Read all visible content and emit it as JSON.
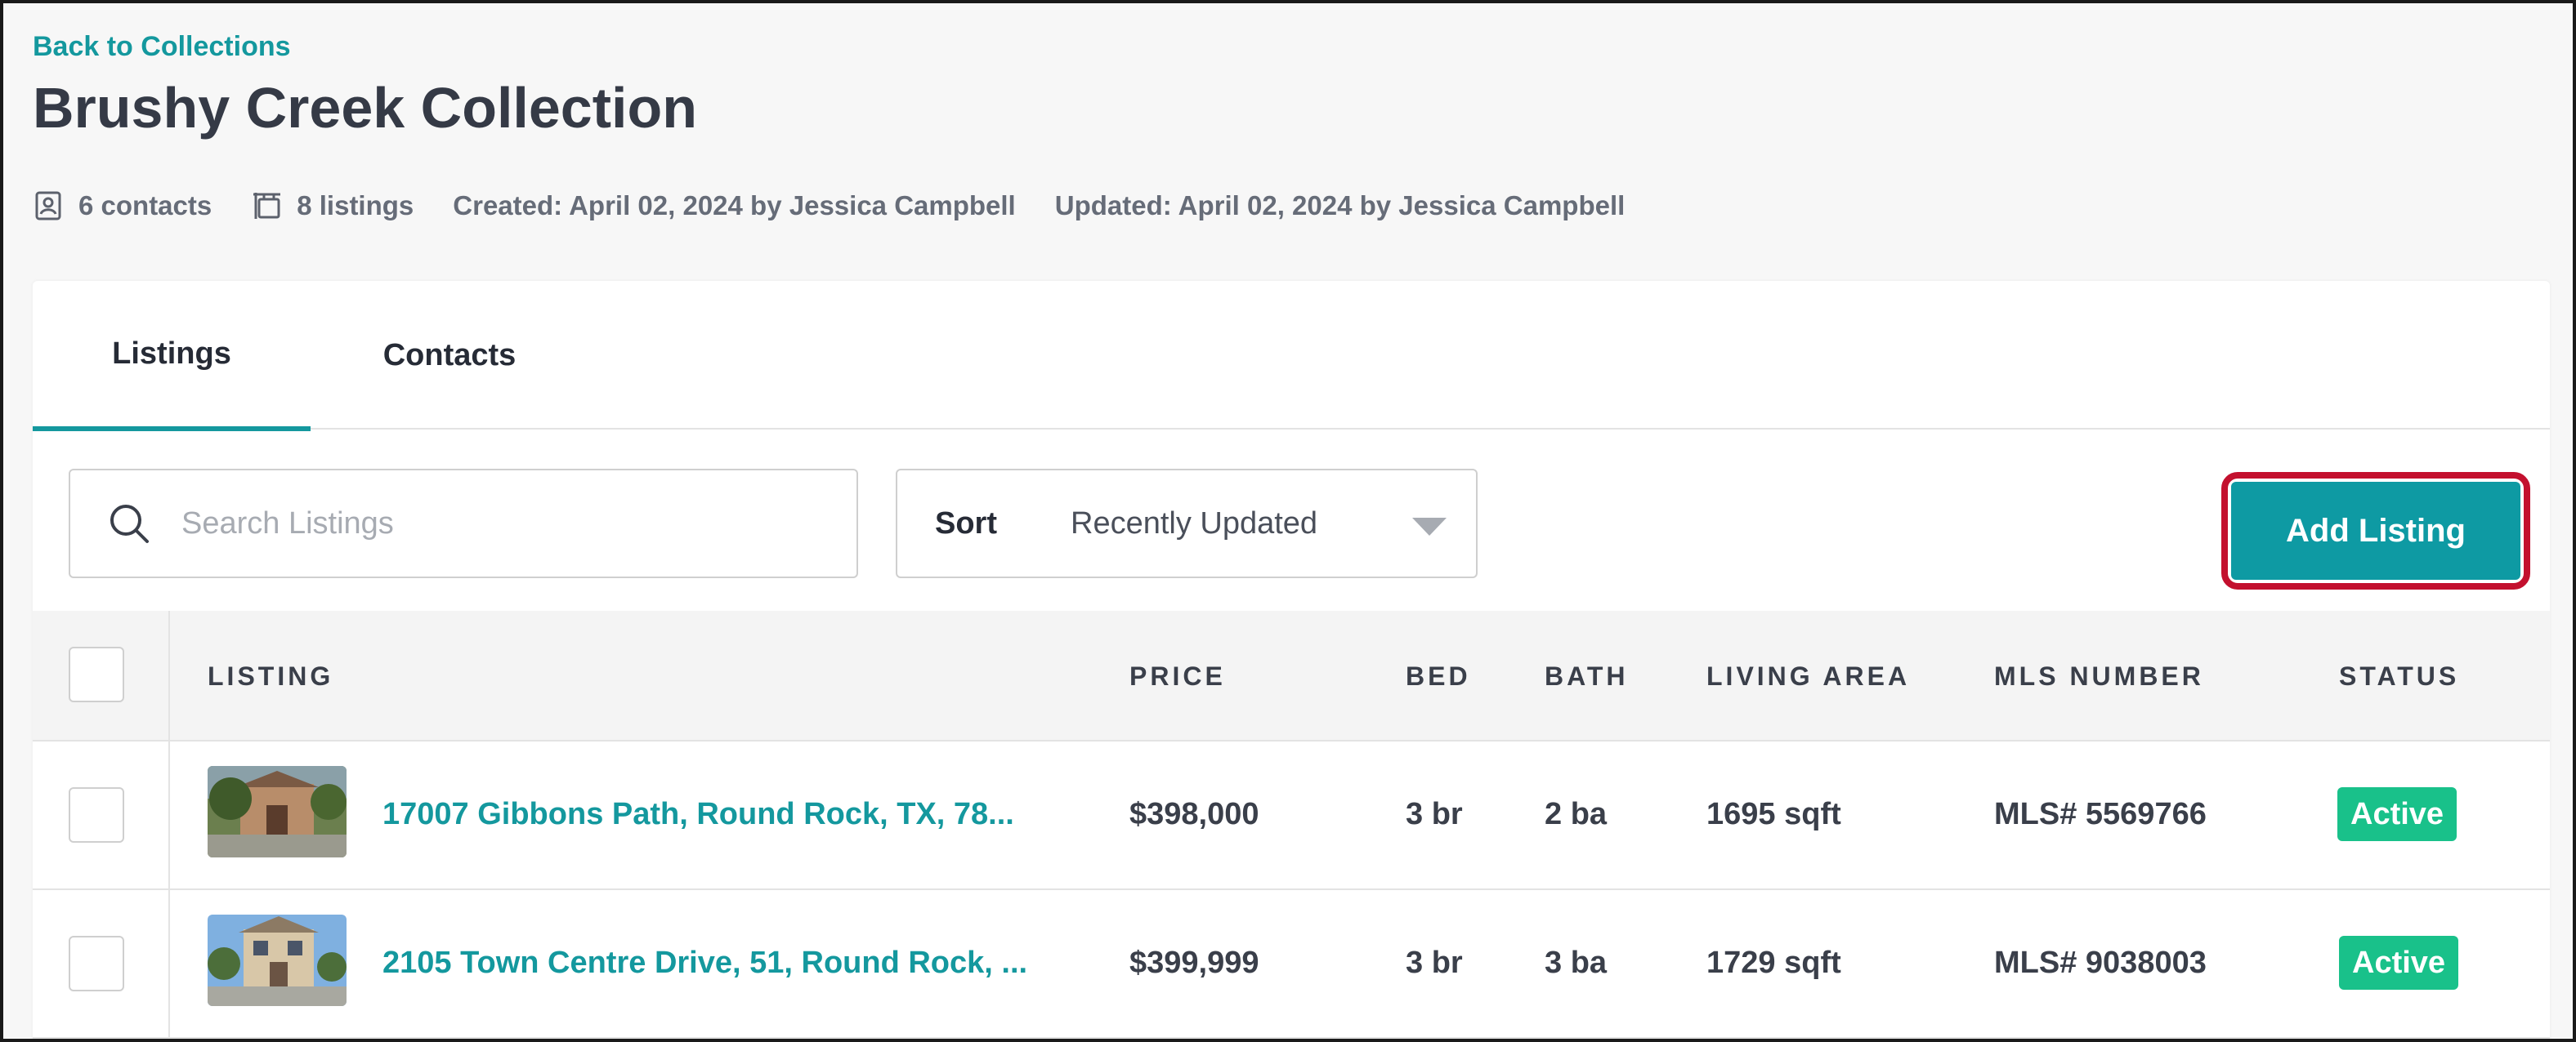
{
  "header": {
    "back_link": "Back to Collections",
    "title": "Brushy Creek Collection"
  },
  "meta": {
    "contacts": "6 contacts",
    "listings": "8 listings",
    "created": "Created: April 02, 2024 by Jessica Campbell",
    "updated": "Updated: April 02, 2024 by Jessica Campbell"
  },
  "tabs": [
    {
      "label": "Listings",
      "active": true
    },
    {
      "label": "Contacts",
      "active": false
    }
  ],
  "toolbar": {
    "search_placeholder": "Search Listings",
    "sort_label": "Sort",
    "sort_value": "Recently Updated",
    "add_label": "Add Listing"
  },
  "table": {
    "headers": {
      "listing": "LISTING",
      "price": "PRICE",
      "bed": "BED",
      "bath": "BATH",
      "living_area": "LIVING AREA",
      "mls": "MLS NUMBER",
      "status": "STATUS"
    },
    "rows": [
      {
        "address": "17007 Gibbons Path, Round Rock, TX, 78...",
        "price": "$398,000",
        "bed": "3 br",
        "bath": "2 ba",
        "area": "1695 sqft",
        "mls": "MLS# 5569766",
        "status": "Active"
      },
      {
        "address": "2105 Town Centre Drive, 51, Round Rock, ...",
        "price": "$399,999",
        "bed": "3 br",
        "bath": "3 ba",
        "area": "1729 sqft",
        "mls": "MLS# 9038003",
        "status": "Active"
      }
    ]
  },
  "colors": {
    "accent": "#14989e",
    "button": "#0e9aa3",
    "highlight_ring": "#c3102e",
    "status_active": "#19c18a"
  }
}
